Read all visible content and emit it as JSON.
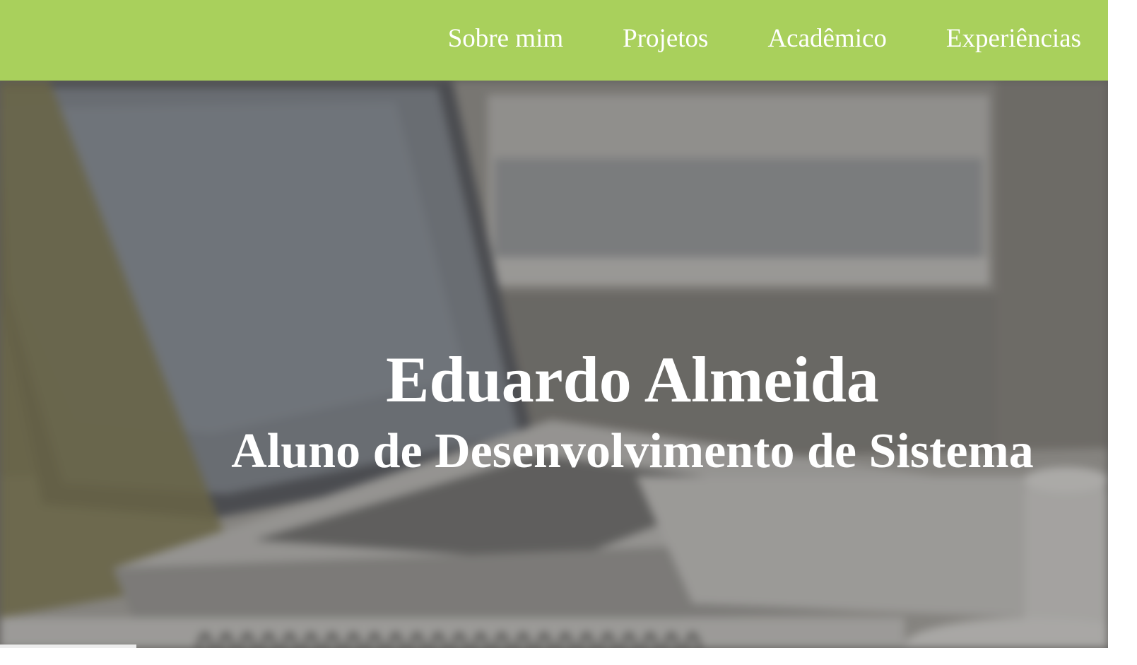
{
  "nav": {
    "items": [
      {
        "label": "Sobre mim"
      },
      {
        "label": "Projetos"
      },
      {
        "label": "Acadêmico"
      },
      {
        "label": "Experiências"
      }
    ]
  },
  "hero": {
    "title": "Eduardo Almeida",
    "subtitle": "Aluno de Desenvolvimento de Sistema"
  },
  "colors": {
    "header_bg": "#a9d05c",
    "text": "#ffffff"
  }
}
